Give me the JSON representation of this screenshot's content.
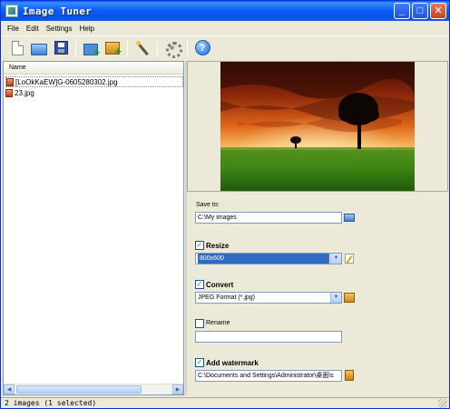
{
  "window": {
    "title": "Image Tuner"
  },
  "menu": [
    "File",
    "Edit",
    "Settings",
    "Help"
  ],
  "toolbar": {
    "buttons": [
      "new-icon",
      "open-icon",
      "save-icon",
      "add-folder-icon",
      "add-images-icon",
      "wand-icon",
      "gear-icon",
      "help-icon"
    ]
  },
  "file_list": {
    "header": "Name",
    "items": [
      "[LoOkKaEW]G-0605280302.jpg",
      "23.jpg"
    ]
  },
  "settings": {
    "save_to_label": "Save to:",
    "save_to_value": "C:\\My images",
    "resize_label": "Resize",
    "resize_checked": true,
    "resize_value": "800x600",
    "convert_label": "Convert",
    "convert_checked": true,
    "convert_value": "JPEG Format (*.jpg)",
    "rename_label": "Rename",
    "rename_checked": false,
    "rename_value": "",
    "watermark_label": "Add watermark",
    "watermark_checked": true,
    "watermark_value": "C:\\Documents and Settings\\Administrator\\桌面\\s"
  },
  "status": {
    "text": "2 images (1 selected)"
  },
  "colors": {
    "title_bar": "#0a5ef8",
    "selection": "#316ac5",
    "window_bg": "#ece9d8"
  }
}
